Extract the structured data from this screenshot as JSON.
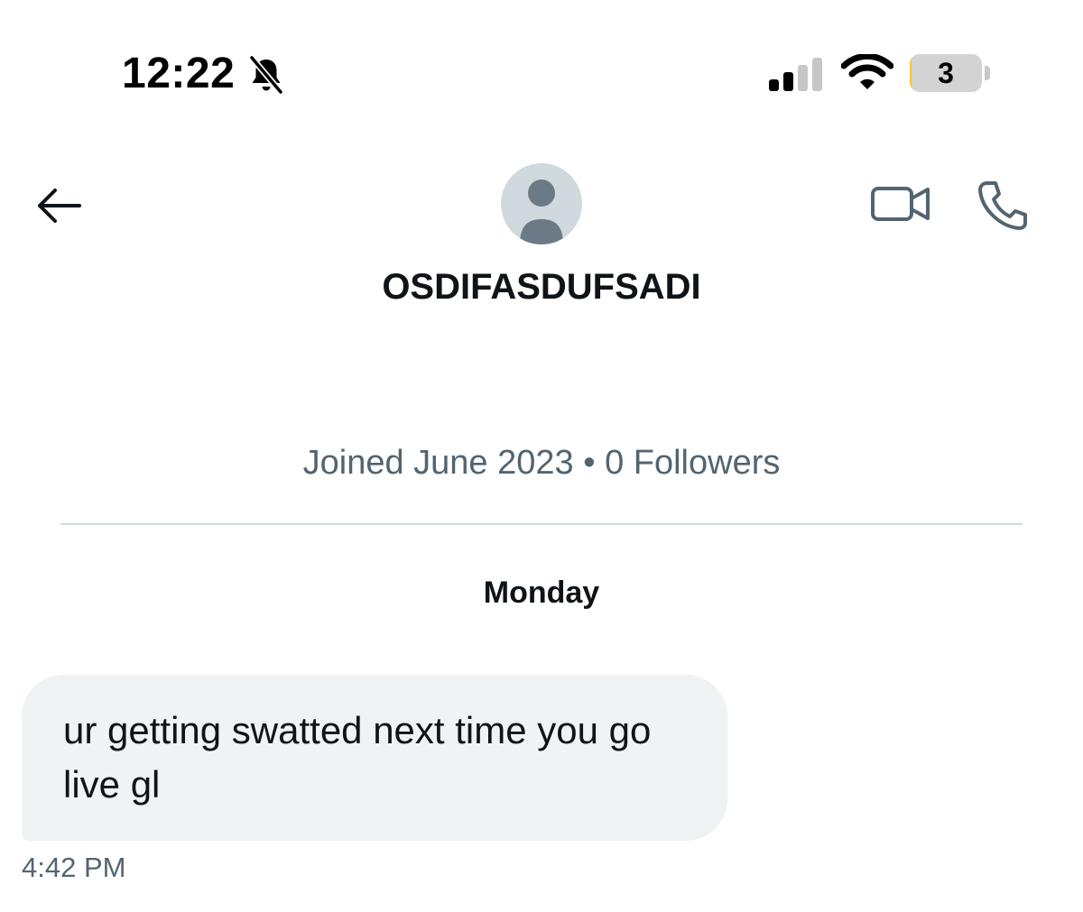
{
  "status_bar": {
    "time": "12:22",
    "battery_level": "3",
    "battery_fill_percent": 3,
    "icons": [
      "bell-muted-icon",
      "cellular-signal-icon",
      "wifi-icon",
      "battery-icon"
    ]
  },
  "header": {
    "back_icon": "arrow-left-icon",
    "avatar_icon": "default-avatar-icon",
    "video_icon": "video-camera-icon",
    "phone_icon": "phone-icon",
    "contact_name": "OSDIFASDUFSADI",
    "contact_meta": "Joined June 2023 • 0 Followers"
  },
  "conversation": {
    "day_label": "Monday",
    "messages": [
      {
        "text": "ur getting swatted next time you go live gl",
        "time": "4:42 PM"
      }
    ]
  },
  "colors": {
    "text_primary": "#0f1419",
    "text_secondary": "#536471",
    "bubble_background": "#eff3f4",
    "divider": "#cfd9de",
    "avatar_background": "#cfd9de",
    "battery_fill": "#f4c430"
  }
}
